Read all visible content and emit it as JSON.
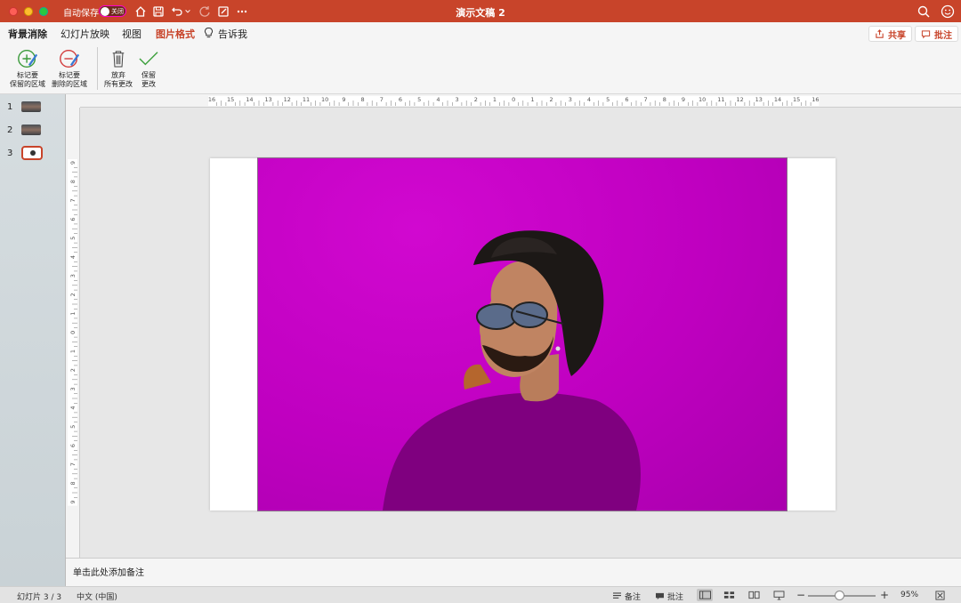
{
  "titlebar": {
    "autosave_label": "自动保存",
    "autosave_state": "关闭",
    "doc_title": "演示文稿 2"
  },
  "tabs": [
    {
      "label": "背景消除"
    },
    {
      "label": "幻灯片放映"
    },
    {
      "label": "视图"
    },
    {
      "label": "图片格式"
    },
    {
      "label": "告诉我"
    }
  ],
  "actions": {
    "share": "共享",
    "comments": "批注"
  },
  "ribbon": {
    "mark_keep_line1": "标记要",
    "mark_keep_line2": "保留的区域",
    "mark_remove_line1": "标记要",
    "mark_remove_line2": "删除的区域",
    "discard_line1": "放弃",
    "discard_line2": "所有更改",
    "keep_line1": "保留",
    "keep_line2": "更改"
  },
  "slides": [
    {
      "number": "1"
    },
    {
      "number": "2"
    },
    {
      "number": "3"
    }
  ],
  "ruler": {
    "horizontal_ticks": [
      "16",
      "15",
      "14",
      "13",
      "12",
      "11",
      "10",
      "9",
      "8",
      "7",
      "6",
      "5",
      "4",
      "3",
      "2",
      "1",
      "0",
      "1",
      "2",
      "3",
      "4",
      "5",
      "6",
      "7",
      "8",
      "9",
      "10",
      "11",
      "12",
      "13",
      "14",
      "15",
      "16"
    ],
    "vertical_ticks": [
      "9",
      "8",
      "7",
      "6",
      "5",
      "4",
      "3",
      "2",
      "1",
      "0",
      "1",
      "2",
      "3",
      "4",
      "5",
      "6",
      "7",
      "8",
      "9"
    ]
  },
  "notes_placeholder": "单击此处添加备注",
  "status": {
    "slide_count": "幻灯片 3 / 3",
    "language": "中文 (中国)",
    "notes": "备注",
    "comments": "批注",
    "zoom": "95%"
  },
  "colors": {
    "accent": "#c8442a",
    "background_magenta": "#c000c0"
  }
}
